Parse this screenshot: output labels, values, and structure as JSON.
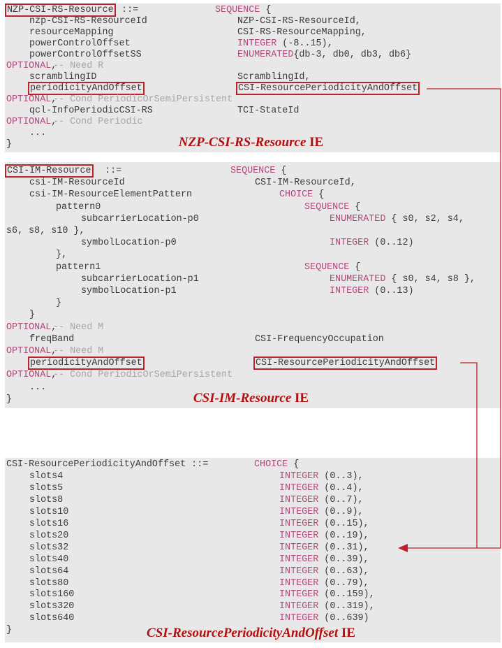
{
  "colors": {
    "keyword": "#b04a7c",
    "comment": "#a6a6a6",
    "highlight": "#c0202a"
  },
  "panels": [
    {
      "title": {
        "name": "NZP-CSI-RS-Resource",
        "suffix": "IE"
      },
      "lines": [
        [
          {
            "text": "NZP-CSI-RS-Resource",
            "box": true
          },
          {
            "text": " ::="
          },
          {
            "kw": "SEQUENCE",
            "text": " {"
          }
        ],
        [
          {
            "text": "nzp-CSI-RS-ResourceId"
          },
          {
            "text": "NZP-CSI-RS-ResourceId,"
          }
        ],
        [
          {
            "text": "resourceMapping"
          },
          {
            "text": "CSI-RS-ResourceMapping,"
          }
        ],
        [
          {
            "text": "powerControlOffset"
          },
          {
            "kw": "INTEGER",
            "text": " (-8..15),"
          }
        ],
        [
          {
            "text": "powerControlOffsetSS"
          },
          {
            "kw": "ENUMERATED",
            "text": "{db-3, db0, db3, db6}"
          }
        ],
        [
          {
            "kw": "OPTIONAL",
            "text": ","
          },
          {
            "comment": "-- Need R"
          }
        ],
        [
          {
            "text": "scramblingID"
          },
          {
            "text": "ScramblingId,"
          }
        ],
        [
          {
            "text": "periodicityAndOffset",
            "box": true
          },
          {
            "text": "CSI-ResourcePeriodicityAndOffset",
            "box": true
          }
        ],
        [
          {
            "kw": "OPTIONAL",
            "text": ","
          },
          {
            "comment": "-- Cond PeriodicOrSemiPersistent"
          }
        ],
        [
          {
            "text": "qcl-InfoPeriodicCSI-RS"
          },
          {
            "text": "TCI-StateId"
          }
        ],
        [
          {
            "kw": "OPTIONAL",
            "text": ","
          },
          {
            "comment": "-- Cond Periodic"
          }
        ],
        [
          {
            "text": "..."
          }
        ],
        [
          {
            "text": "}"
          }
        ]
      ]
    },
    {
      "title": {
        "name": "CSI-IM-Resource",
        "suffix": "IE"
      },
      "lines": [
        [
          {
            "text": "CSI-IM-Resource",
            "box": true
          },
          {
            "text": " ::="
          },
          {
            "kw": "SEQUENCE",
            "text": " {"
          }
        ],
        [
          {
            "text": "csi-IM-ResourceId"
          },
          {
            "text": "CSI-IM-ResourceId,"
          }
        ],
        [
          {
            "text": "csi-IM-ResourceElementPattern"
          },
          {
            "kw": "CHOICE",
            "text": " {"
          }
        ],
        [
          {
            "text": "pattern0"
          },
          {
            "kw": "SEQUENCE",
            "text": " {"
          }
        ],
        [
          {
            "text": "subcarrierLocation-p0"
          },
          {
            "kw": "ENUMERATED",
            "text": " { s0, s2, s4,"
          }
        ],
        [
          {
            "text": "s6, s8, s10 },"
          }
        ],
        [
          {
            "text": "symbolLocation-p0"
          },
          {
            "kw": "INTEGER",
            "text": " (0..12)"
          }
        ],
        [
          {
            "text": "},"
          }
        ],
        [
          {
            "text": "pattern1"
          },
          {
            "kw": "SEQUENCE",
            "text": " {"
          }
        ],
        [
          {
            "text": "subcarrierLocation-p1"
          },
          {
            "kw": "ENUMERATED",
            "text": " { s0, s4, s8 },"
          }
        ],
        [
          {
            "text": "symbolLocation-p1"
          },
          {
            "kw": "INTEGER",
            "text": " (0..13)"
          }
        ],
        [
          {
            "text": "}"
          }
        ],
        [
          {
            "text": "}"
          }
        ],
        [
          {
            "kw": "OPTIONAL",
            "text": ","
          },
          {
            "comment": "-- Need M"
          }
        ],
        [
          {
            "text": "freqBand"
          },
          {
            "text": "CSI-FrequencyOccupation"
          }
        ],
        [
          {
            "kw": "OPTIONAL",
            "text": ","
          },
          {
            "comment": "-- Need M"
          }
        ],
        [
          {
            "text": "periodicityAndOffset",
            "box": true
          },
          {
            "text": "CSI-ResourcePeriodicityAndOffset",
            "box": true
          }
        ],
        [
          {
            "kw": "OPTIONAL",
            "text": ","
          },
          {
            "comment": "-- Cond PeriodicOrSemiPersistent"
          }
        ],
        [
          {
            "text": "..."
          }
        ],
        [
          {
            "text": "}"
          }
        ]
      ]
    },
    {
      "title": {
        "name": "CSI-ResourcePeriodicityAndOffset",
        "suffix": "IE"
      },
      "lines": [
        [
          {
            "text": "CSI-ResourcePeriodicityAndOffset ::="
          },
          {
            "kw": "CHOICE",
            "text": " {"
          }
        ],
        [
          {
            "text": "slots4"
          },
          {
            "kw": "INTEGER",
            "text": " (0..3),"
          }
        ],
        [
          {
            "text": "slots5"
          },
          {
            "kw": "INTEGER",
            "text": " (0..4),"
          }
        ],
        [
          {
            "text": "slots8"
          },
          {
            "kw": "INTEGER",
            "text": " (0..7),"
          }
        ],
        [
          {
            "text": "slots10"
          },
          {
            "kw": "INTEGER",
            "text": " (0..9),"
          }
        ],
        [
          {
            "text": "slots16"
          },
          {
            "kw": "INTEGER",
            "text": " (0..15),"
          }
        ],
        [
          {
            "text": "slots20"
          },
          {
            "kw": "INTEGER",
            "text": " (0..19),"
          }
        ],
        [
          {
            "text": "slots32"
          },
          {
            "kw": "INTEGER",
            "text": " (0..31),"
          }
        ],
        [
          {
            "text": "slots40"
          },
          {
            "kw": "INTEGER",
            "text": " (0..39),"
          }
        ],
        [
          {
            "text": "slots64"
          },
          {
            "kw": "INTEGER",
            "text": " (0..63),"
          }
        ],
        [
          {
            "text": "slots80"
          },
          {
            "kw": "INTEGER",
            "text": " (0..79),"
          }
        ],
        [
          {
            "text": "slots160"
          },
          {
            "kw": "INTEGER",
            "text": " (0..159),"
          }
        ],
        [
          {
            "text": "slots320"
          },
          {
            "kw": "INTEGER",
            "text": " (0..319),"
          }
        ],
        [
          {
            "text": "slots640"
          },
          {
            "kw": "INTEGER",
            "text": " (0..639)"
          }
        ],
        [
          {
            "text": "}"
          }
        ]
      ]
    }
  ]
}
